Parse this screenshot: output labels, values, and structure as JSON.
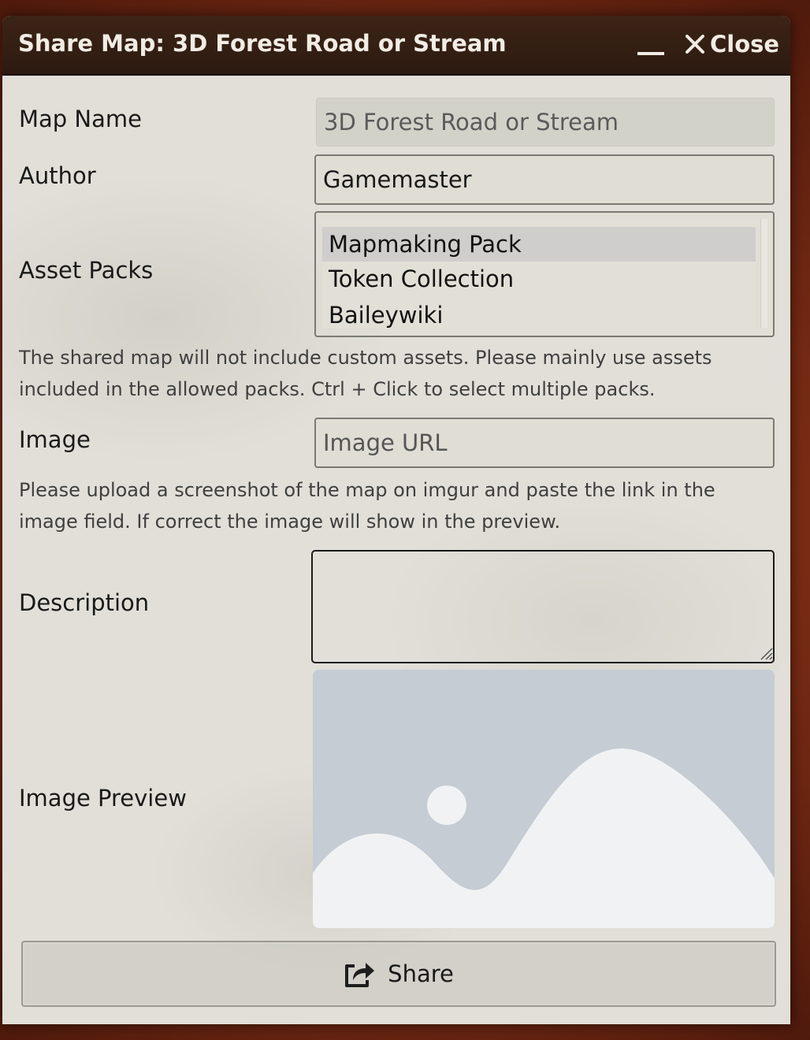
{
  "window": {
    "title": "Share Map: 3D Forest Road or Stream",
    "close_label": "Close"
  },
  "form": {
    "map_name": {
      "label": "Map Name",
      "value": "3D Forest Road or Stream"
    },
    "author": {
      "label": "Author",
      "value": "Gamemaster"
    },
    "asset_packs": {
      "label": "Asset Packs",
      "options": [
        "Mapmaking Pack",
        "Token Collection",
        "Baileywiki"
      ],
      "selected": "Mapmaking Pack"
    },
    "asset_help": "The shared map will not include custom assets. Please mainly use assets included in the allowed packs. Ctrl + Click to select multiple packs.",
    "image": {
      "label": "Image",
      "placeholder": "Image URL"
    },
    "image_help": "Please upload a screenshot of the map on imgur and paste the link in the image field. If correct the image will show in the preview.",
    "description": {
      "label": "Description",
      "value": ""
    },
    "image_preview": {
      "label": "Image Preview"
    }
  },
  "share_button": {
    "label": "Share",
    "icon": "share-icon"
  },
  "colors": {
    "titlebar": "#2c1a10",
    "panel": "#e1dfd8",
    "preview_bg": "#c5ccd3",
    "preview_shapes": "#f1f2f4"
  }
}
